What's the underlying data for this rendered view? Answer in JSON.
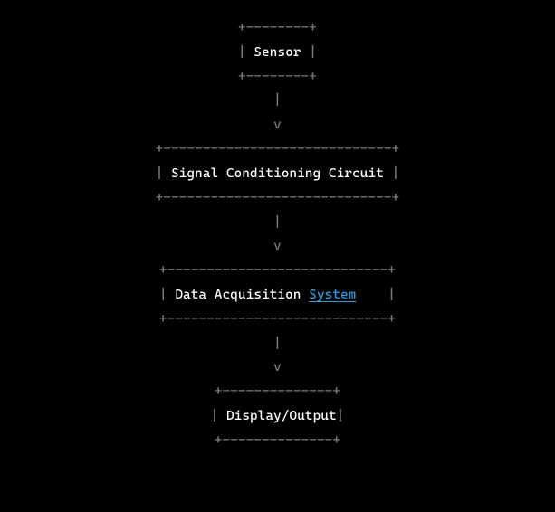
{
  "chart_data": {
    "type": "flowchart",
    "nodes": [
      {
        "id": "sensor",
        "label": "Sensor"
      },
      {
        "id": "conditioning",
        "label": "Signal Conditioning Circuit"
      },
      {
        "id": "daq",
        "label_pre": "Data Acquisition ",
        "label_link": "System",
        "label_post": ""
      },
      {
        "id": "output",
        "label": "Display/Output"
      }
    ],
    "edges": [
      {
        "from": "sensor",
        "to": "conditioning"
      },
      {
        "from": "conditioning",
        "to": "daq"
      },
      {
        "from": "daq",
        "to": "output"
      }
    ],
    "direction": "top-to-bottom"
  },
  "ascii": {
    "box1_border": "+--------+",
    "box1_side": "|",
    "box1_label": "Sensor",
    "arrow_pipe": "|",
    "arrow_head": "v",
    "box2_border": "+-----------------------------+",
    "box2_side": "|",
    "box2_label": "Signal Conditioning Circuit",
    "box3_border": "+----------------------------+",
    "box3_side": "|",
    "box3_pre": "Data Acquisition ",
    "box3_link": "System",
    "box3_pad": "   ",
    "box4_border": "+--------------+",
    "box4_side": "|",
    "box4_label": "Display/Output"
  }
}
